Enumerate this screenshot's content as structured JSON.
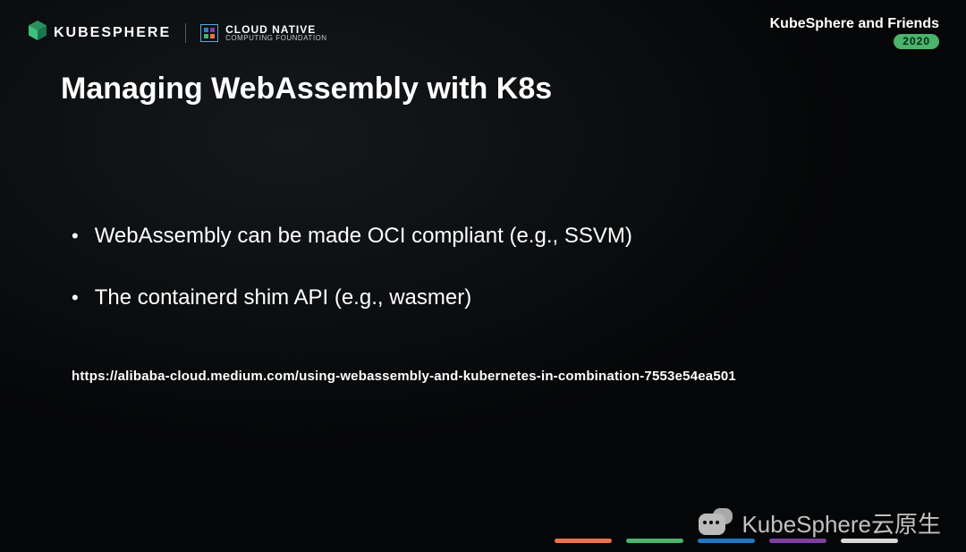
{
  "header": {
    "kubesphere_label": "KUBESPHERE",
    "cncf_line1": "CLOUD NATIVE",
    "cncf_line2": "COMPUTING FOUNDATION",
    "right_title": "KubeSphere and Friends",
    "right_badge": "2020"
  },
  "slide": {
    "title": "Managing WebAssembly with K8s",
    "bullets": [
      "WebAssembly can be made OCI compliant (e.g., SSVM)",
      "The containerd shim API (e.g., wasmer)"
    ],
    "reference_url": "https://alibaba-cloud.medium.com/using-webassembly-and-kubernetes-in-combination-7553e54ea501"
  },
  "footer": {
    "dash_colors": [
      "#e9734c",
      "#4bb36c",
      "#1f78c1",
      "#7f3fa0",
      "#d8d8d8"
    ],
    "watermark_text": "KubeSphere云原生"
  }
}
